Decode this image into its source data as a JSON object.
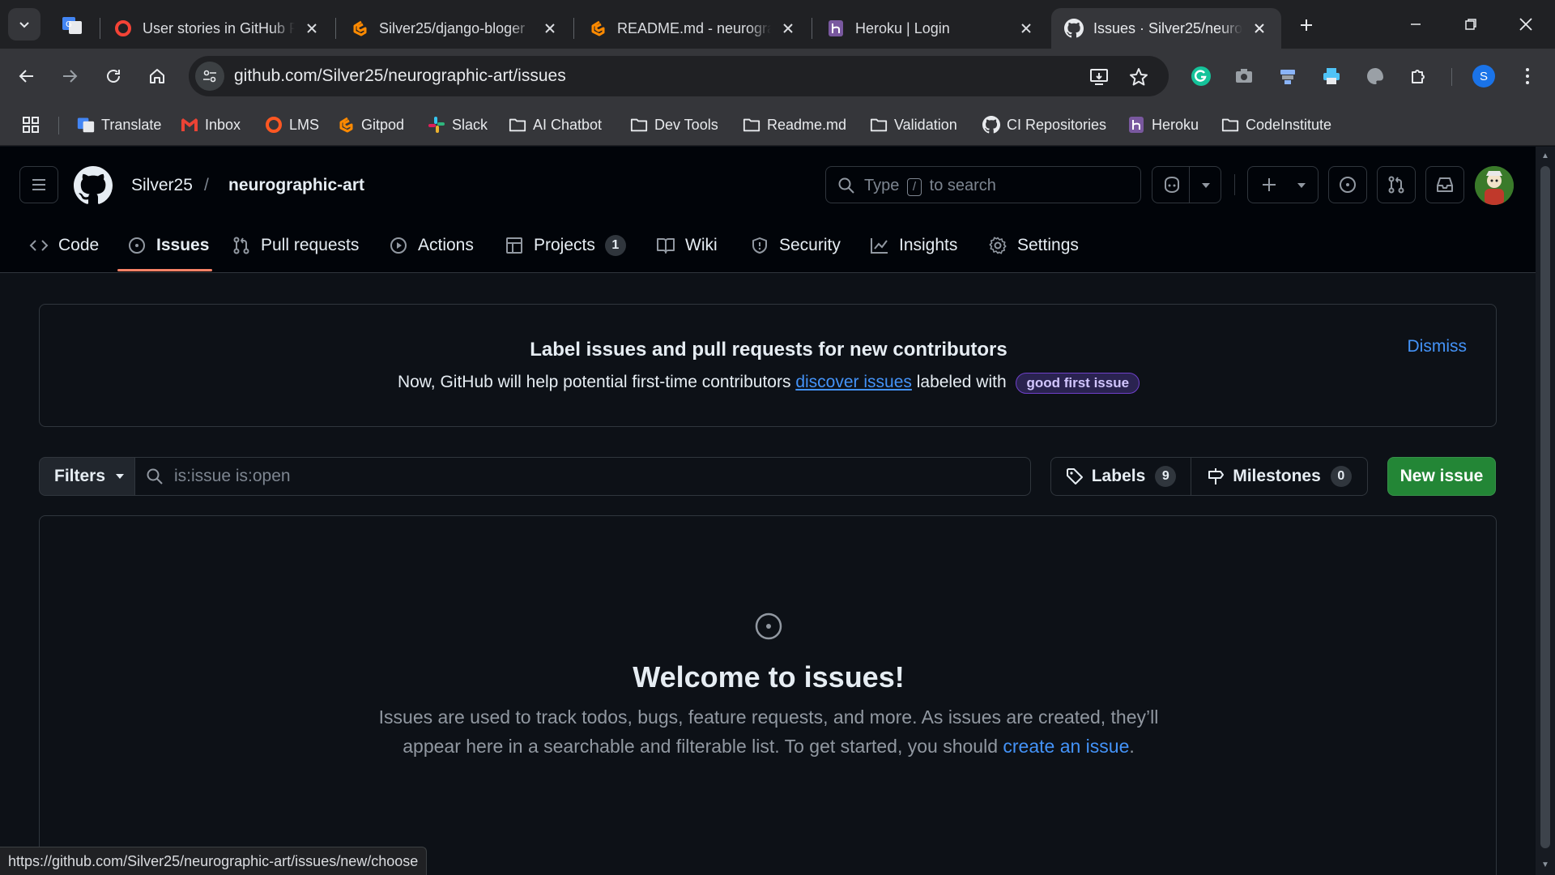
{
  "browser": {
    "tabs": [
      {
        "title": "User stories in GitHub P",
        "icon": "red-circle-icon"
      },
      {
        "title": "Silver25/django-bloger",
        "icon": "gitpod-icon"
      },
      {
        "title": "README.md - neurograp",
        "icon": "gitpod-icon"
      },
      {
        "title": "Heroku | Login",
        "icon": "heroku-icon"
      },
      {
        "title": "Issues · Silver25/neurog",
        "icon": "github-icon",
        "active": true
      }
    ],
    "url": "github.com/Silver25/neurographic-art/issues",
    "profile_initial": "S",
    "bookmarks": [
      {
        "label": "Translate",
        "icon": "translate-icon"
      },
      {
        "label": "Inbox",
        "icon": "gmail-icon"
      },
      {
        "label": "LMS",
        "icon": "red-circle-icon"
      },
      {
        "label": "Gitpod",
        "icon": "gitpod-icon"
      },
      {
        "label": "Slack",
        "icon": "slack-icon"
      },
      {
        "label": "AI Chatbot",
        "icon": "folder-icon"
      },
      {
        "label": "Dev Tools",
        "icon": "folder-icon"
      },
      {
        "label": "Readme.md",
        "icon": "folder-icon"
      },
      {
        "label": "Validation",
        "icon": "folder-icon"
      },
      {
        "label": "CI Repositories",
        "icon": "github-icon"
      },
      {
        "label": "Heroku",
        "icon": "heroku-icon"
      },
      {
        "label": "CodeInstitute",
        "icon": "folder-icon"
      }
    ],
    "status_url": "https://github.com/Silver25/neurographic-art/issues/new/choose"
  },
  "repo": {
    "owner": "Silver25",
    "slash": "/",
    "name": "neurographic-art"
  },
  "search": {
    "text_before": "Type",
    "key": "/",
    "text_after": "to search"
  },
  "repo_tabs": [
    {
      "label": "Code",
      "icon": "code-icon"
    },
    {
      "label": "Issues",
      "icon": "issue-opened-icon",
      "active": true
    },
    {
      "label": "Pull requests",
      "icon": "git-pull-request-icon"
    },
    {
      "label": "Actions",
      "icon": "play-icon"
    },
    {
      "label": "Projects",
      "icon": "table-icon",
      "counter": "1"
    },
    {
      "label": "Wiki",
      "icon": "book-icon"
    },
    {
      "label": "Security",
      "icon": "shield-icon"
    },
    {
      "label": "Insights",
      "icon": "graph-icon"
    },
    {
      "label": "Settings",
      "icon": "gear-icon"
    }
  ],
  "banner": {
    "title": "Label issues and pull requests for new contributors",
    "text_before": "Now, GitHub will help potential first-time contributors",
    "link": "discover issues",
    "text_after": "labeled with",
    "label": "good first issue",
    "dismiss": "Dismiss"
  },
  "filter_bar": {
    "filters_label": "Filters",
    "query": "is:issue is:open",
    "labels_label": "Labels",
    "labels_count": "9",
    "milestones_label": "Milestones",
    "milestones_count": "0",
    "new_issue_label": "New issue"
  },
  "empty_state": {
    "title": "Welcome to issues!",
    "text": "Issues are used to track todos, bugs, feature requests, and more. As issues are created, they’ll appear here in a searchable and filterable list. To get started, you should",
    "link": "create an issue",
    "end": "."
  },
  "colors": {
    "accent_link": "#4493f8",
    "new_issue_green": "#238636",
    "active_tab_underline": "#f78166",
    "page_bg": "#0d1117"
  }
}
